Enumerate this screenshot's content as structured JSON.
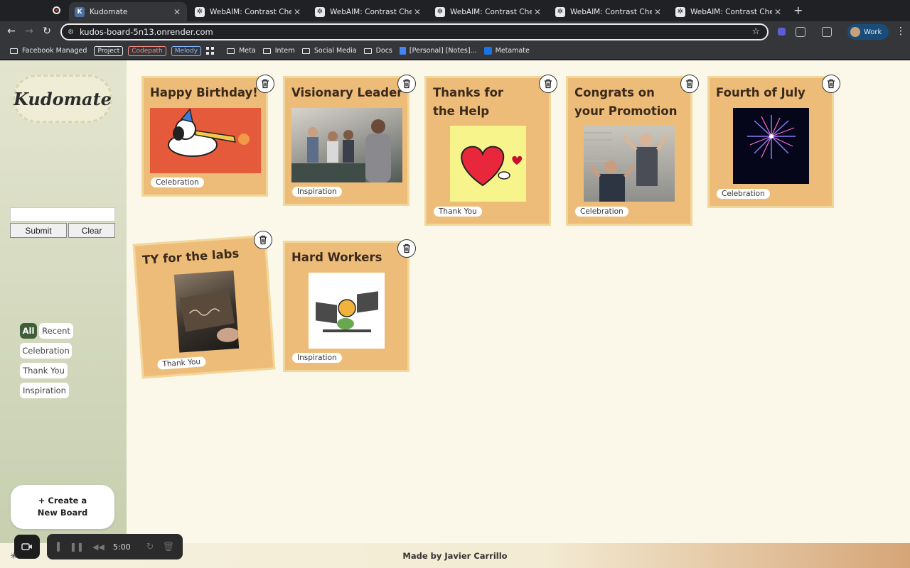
{
  "browser": {
    "tabs": [
      {
        "title": "Kudomate",
        "favicon": "K",
        "active": true
      },
      {
        "title": "WebAIM: Contrast Checker",
        "favicon": "w",
        "active": false
      },
      {
        "title": "WebAIM: Contrast Checker",
        "favicon": "w",
        "active": false
      },
      {
        "title": "WebAIM: Contrast Checker",
        "favicon": "w",
        "active": false
      },
      {
        "title": "WebAIM: Contrast Checker",
        "favicon": "w",
        "active": false
      },
      {
        "title": "WebAIM: Contrast Checker",
        "favicon": "w",
        "active": false
      }
    ],
    "url": "kudos-board-5n13.onrender.com",
    "profile_label": "Work",
    "bookmarks": {
      "facebook": "Facebook Managed",
      "project": "Project",
      "codepath": "Codepath",
      "melody": "Melody",
      "meta": "Meta",
      "intern": "Intern",
      "social": "Social Media",
      "docs": "Docs",
      "notes": "[Personal] [Notes]...",
      "metamate": "Metamate"
    }
  },
  "sidebar": {
    "logo": "Kudomate",
    "search_value": "",
    "submit_label": "Submit",
    "clear_label": "Clear",
    "filters": [
      "All",
      "Recent",
      "Celebration",
      "Thank You",
      "Inspiration"
    ],
    "active_filter": "All",
    "create_label": "+ Create a\nNew Board"
  },
  "boards": [
    {
      "title": "Happy Birthday!",
      "tag": "Celebration",
      "image": "snoopy-party-gif"
    },
    {
      "title": "Visionary Leader",
      "tag": "Inspiration",
      "image": "office-team-photo"
    },
    {
      "title": "Thanks for the Help",
      "tag": "Thank You",
      "image": "heart-gif"
    },
    {
      "title": "Congrats on your Promotion",
      "tag": "Celebration",
      "image": "office-celebration-gif"
    },
    {
      "title": "Fourth of July",
      "tag": "Celebration",
      "image": "fireworks-gif"
    },
    {
      "title": "TY for the labs",
      "tag": "Thank You",
      "image": "thank-you-note-photo"
    },
    {
      "title": "Hard Workers",
      "tag": "Inspiration",
      "image": "working-cat-gif"
    }
  ],
  "footer": "Made by Javier Carrillo",
  "recorder": {
    "time": "5:00"
  },
  "colors": {
    "card": "#eebc79",
    "card_border": "#f2d79b",
    "active_filter": "#3f5e38",
    "page_bg": "#fbf8ea"
  }
}
